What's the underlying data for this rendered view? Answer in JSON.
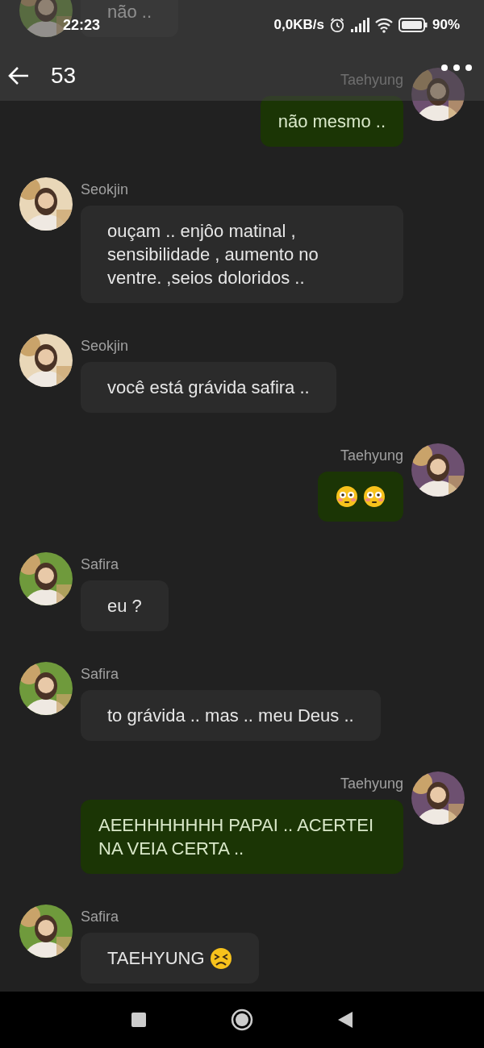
{
  "status_bar": {
    "time": "22:23",
    "speed": "0,0KB/s",
    "battery": "90%"
  },
  "app_bar": {
    "title": "53"
  },
  "messages": [
    {
      "kind": "incoming",
      "text": "não .."
    },
    {
      "kind": "outgoing",
      "sender": "Taehyung",
      "color": "#6d5070",
      "text": "não mesmo .."
    },
    {
      "kind": "incoming",
      "sender": "Seokjin",
      "color": "#e9d7b8",
      "text": "ouçam .. enjôo matinal , sensibilidade , aumento no ventre. ,seios doloridos .."
    },
    {
      "kind": "incoming",
      "sender": "Seokjin",
      "color": "#e9d7b8",
      "text": "você está grávida safira .."
    },
    {
      "kind": "outgoing",
      "sender": "Taehyung",
      "color": "#6d5070",
      "emojis": [
        {
          "kind": "flushed"
        },
        {
          "kind": "flushed"
        }
      ]
    },
    {
      "kind": "incoming",
      "sender": "Safira",
      "color": "#6f9a3c",
      "text": "eu ?"
    },
    {
      "kind": "incoming",
      "sender": "Safira",
      "color": "#6f9a3c",
      "text": "to grávida .. mas .. meu Deus .."
    },
    {
      "kind": "outgoing",
      "sender": "Taehyung",
      "color": "#6d5070",
      "text": "AEEHHHHHHH PAPAI .. ACERTEI NA VEIA CERTA .."
    },
    {
      "kind": "incoming",
      "sender": "Safira",
      "color": "#6f9a3c",
      "text": "TAEHYUNG",
      "emojis": [
        {
          "kind": "persevering"
        }
      ]
    }
  ]
}
